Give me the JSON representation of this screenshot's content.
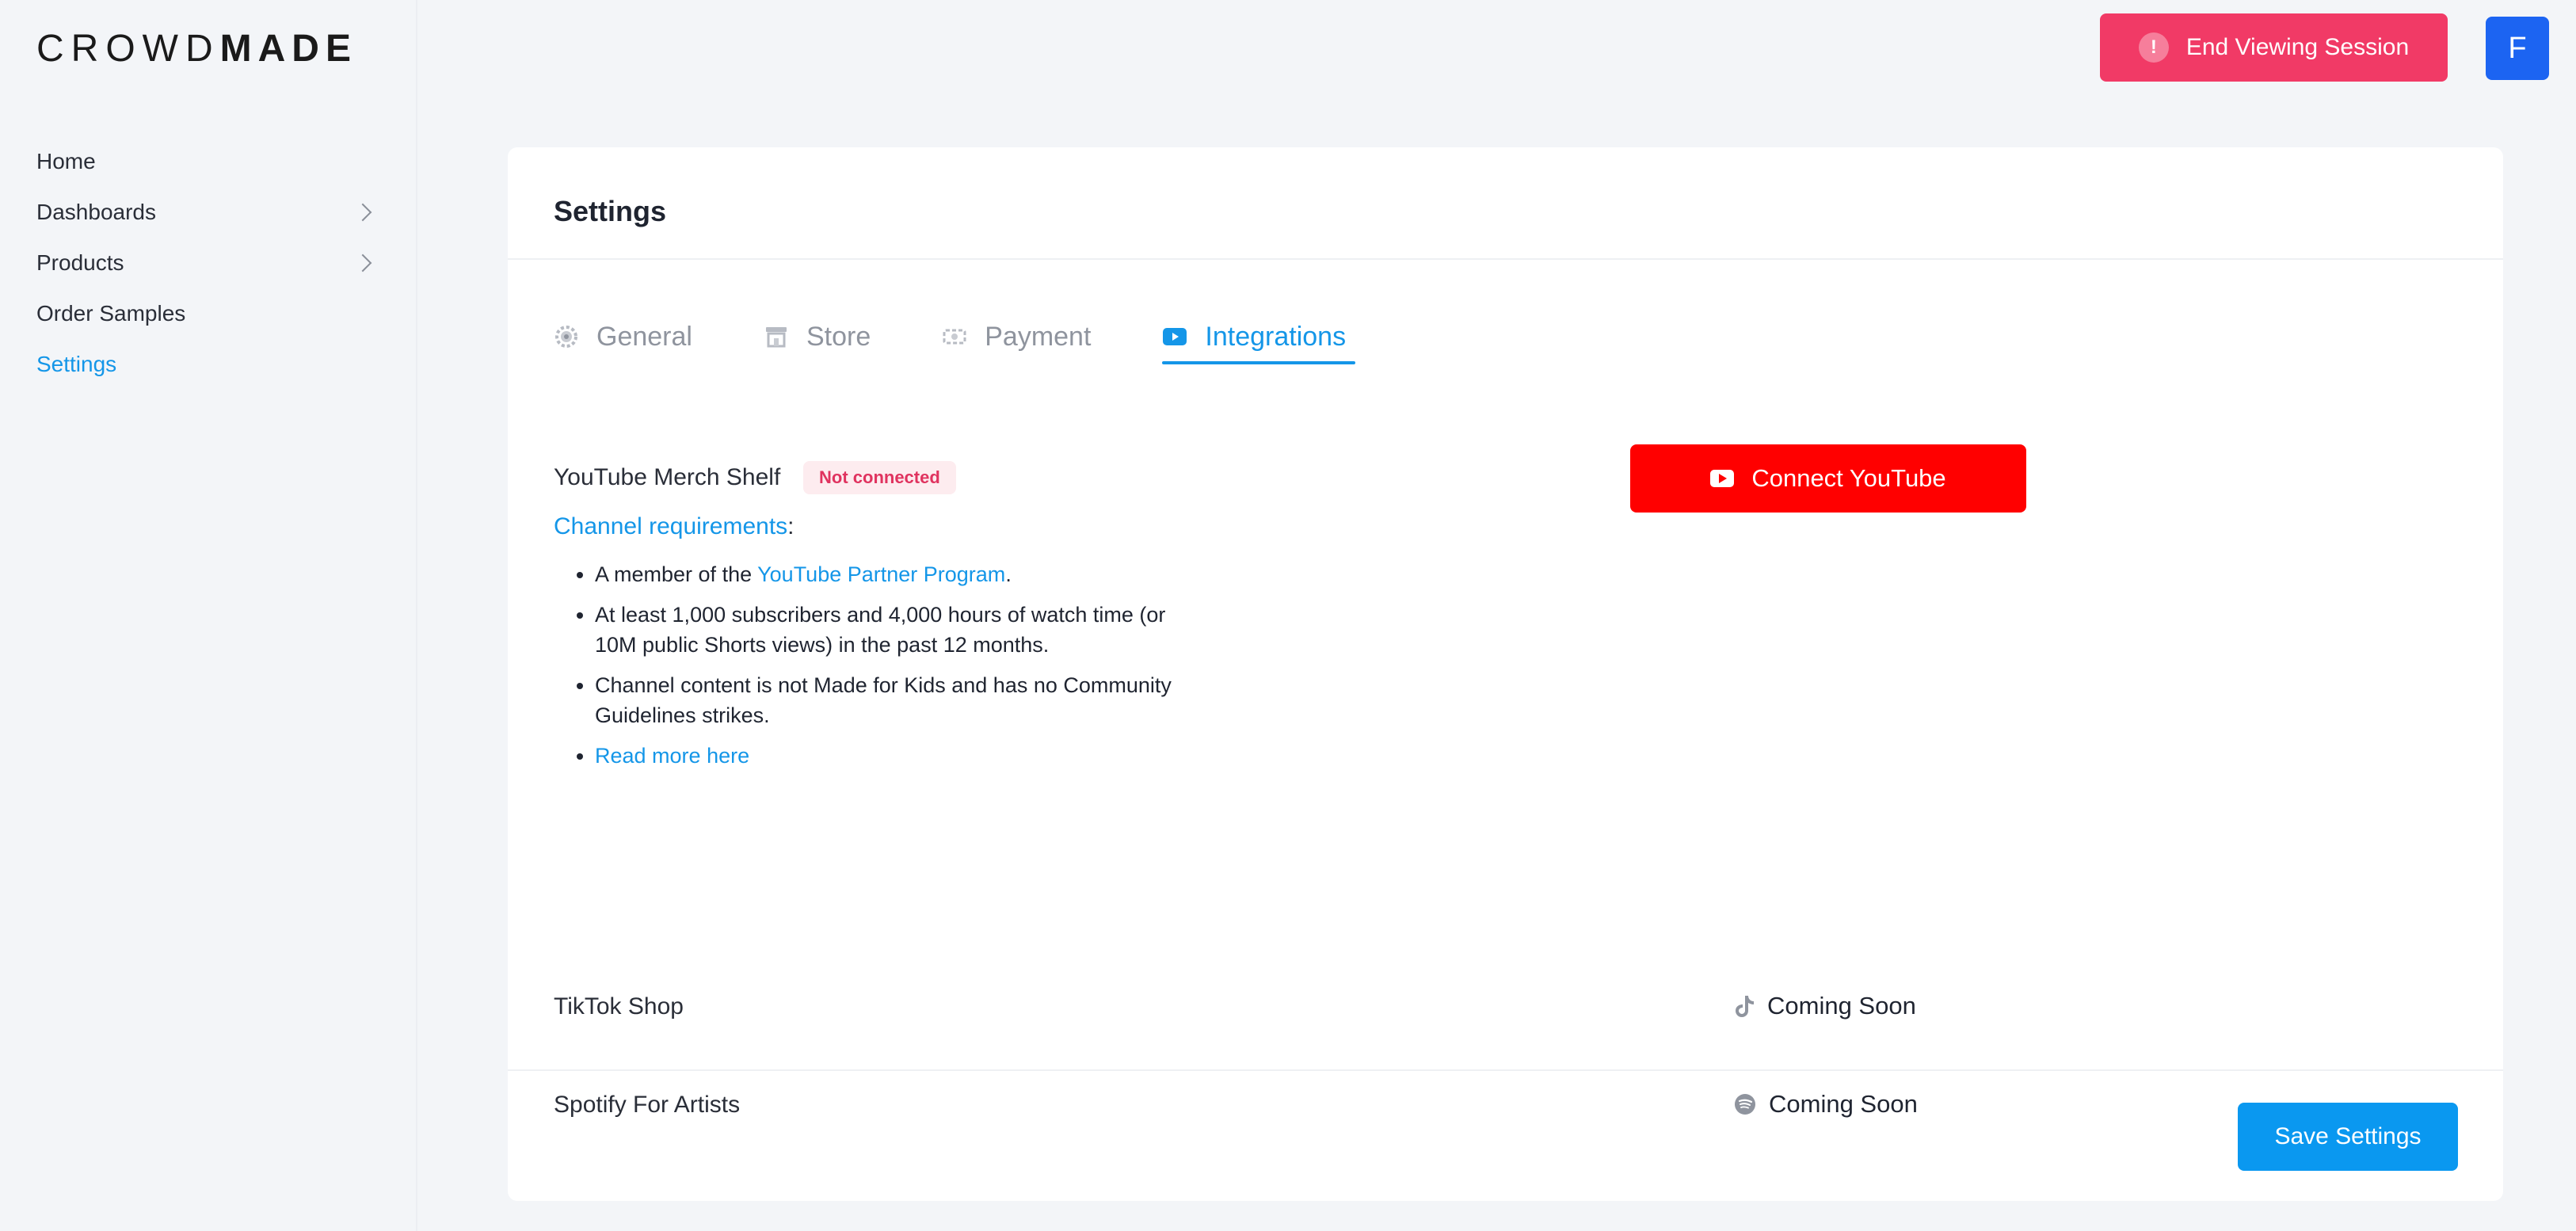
{
  "brand": {
    "logo_light": "CROWD",
    "logo_bold": "MADE"
  },
  "sidebar": {
    "items": [
      {
        "label": "Home"
      },
      {
        "label": "Dashboards"
      },
      {
        "label": "Products"
      },
      {
        "label": "Order Samples"
      },
      {
        "label": "Settings"
      }
    ]
  },
  "header": {
    "end_session_label": "End Viewing Session",
    "avatar_initial": "F"
  },
  "settings": {
    "title": "Settings",
    "tabs": [
      {
        "label": "General",
        "icon": "gear-icon"
      },
      {
        "label": "Store",
        "icon": "store-icon"
      },
      {
        "label": "Payment",
        "icon": "payment-icon"
      },
      {
        "label": "Integrations",
        "icon": "youtube-icon"
      }
    ],
    "youtube": {
      "label": "YouTube Merch Shelf",
      "status": "Not connected",
      "requirements_link": "Channel requirements",
      "requirements_colon": ":",
      "req1_prefix": "A member of the ",
      "req1_link": "YouTube Partner Program",
      "req1_suffix": ".",
      "req2": "At least 1,000 subscribers and 4,000 hours of watch time (or 10M public Shorts views) in the past 12 months.",
      "req3": "Channel content is not Made for Kids and has no Community Guidelines strikes.",
      "read_more": "Read more here",
      "connect_label": "Connect YouTube"
    },
    "tiktok": {
      "label": "TikTok Shop",
      "status": "Coming Soon"
    },
    "spotify": {
      "label": "Spotify For Artists",
      "status": "Coming Soon"
    },
    "save_label": "Save Settings"
  },
  "colors": {
    "accent": "#1496e8",
    "danger": "#f13a66",
    "youtube": "#ff0000",
    "avatar": "#1c64f2"
  }
}
